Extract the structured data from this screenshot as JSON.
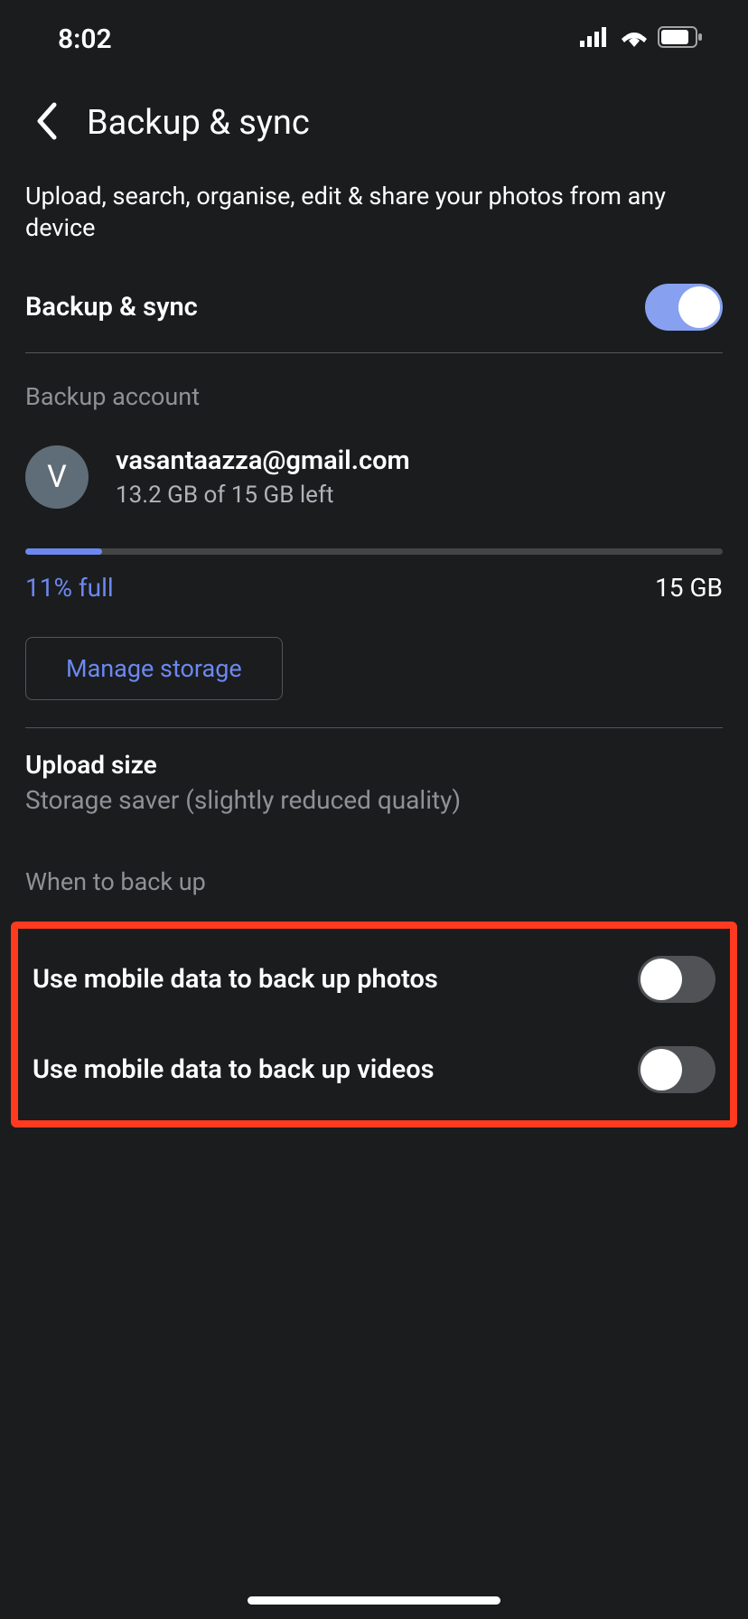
{
  "statusBar": {
    "time": "8:02"
  },
  "header": {
    "title": "Backup & sync"
  },
  "description": "Upload, search, organise, edit & share your photos from any device",
  "backupSync": {
    "label": "Backup & sync",
    "enabled": true
  },
  "backupAccount": {
    "sectionTitle": "Backup account",
    "avatarInitial": "V",
    "email": "vasantaazza@gmail.com",
    "storageText": "13.2 GB of 15 GB left",
    "progressPercent": 11,
    "percentLabel": "11% full",
    "totalStorage": "15 GB",
    "manageButton": "Manage storage"
  },
  "uploadSize": {
    "title": "Upload size",
    "subtitle": "Storage saver (slightly reduced quality)"
  },
  "whenToBackup": {
    "sectionTitle": "When to back up",
    "mobilePhotos": {
      "label": "Use mobile data to back up photos",
      "enabled": false
    },
    "mobileVideos": {
      "label": "Use mobile data to back up videos",
      "enabled": false
    }
  }
}
